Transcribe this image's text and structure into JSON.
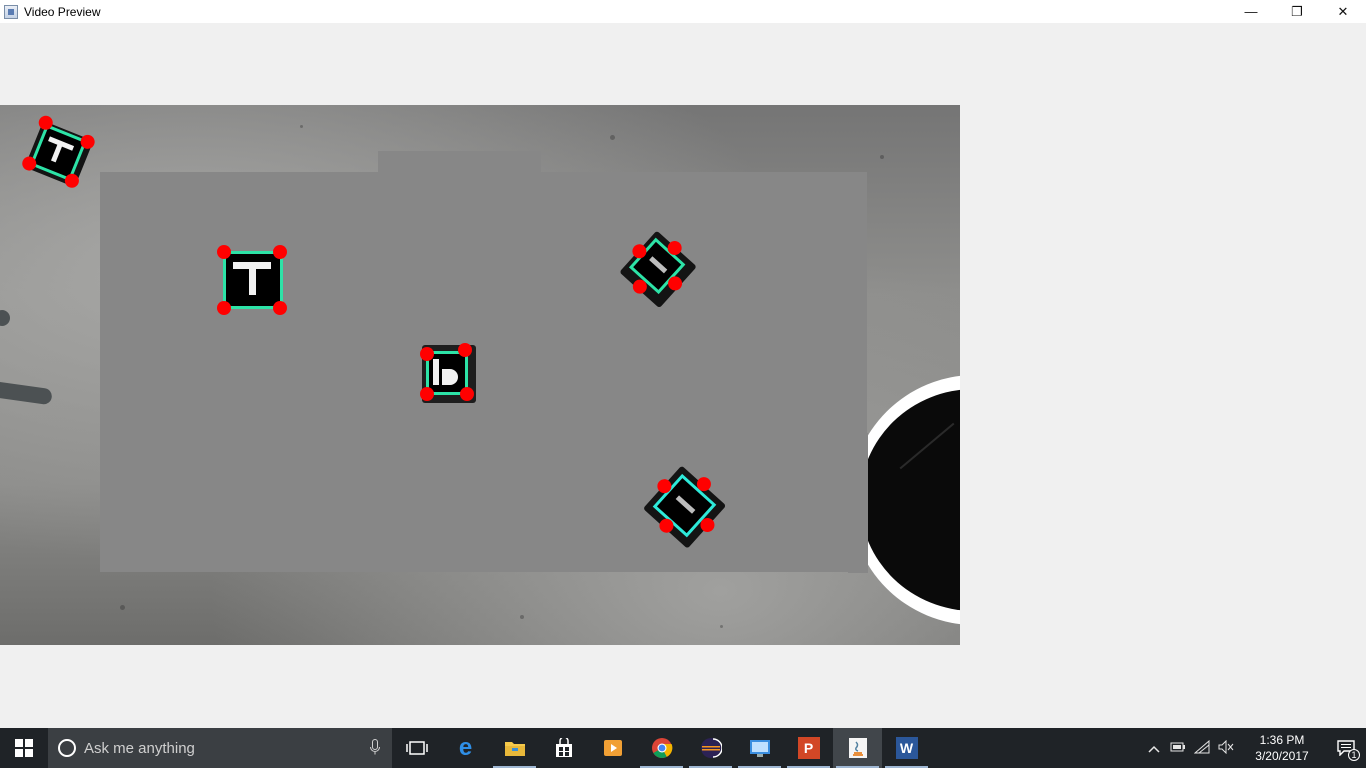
{
  "window": {
    "title": "Video Preview",
    "controls": {
      "minimize": "—",
      "restore": "❐",
      "close": "✕"
    }
  },
  "video": {
    "markers": [
      {
        "name": "marker-top-left-corner"
      },
      {
        "name": "marker-t-shape"
      },
      {
        "name": "marker-center"
      },
      {
        "name": "marker-right-upper"
      },
      {
        "name": "marker-right-lower"
      }
    ]
  },
  "taskbar": {
    "search_placeholder": "Ask me anything",
    "apps": [
      {
        "name": "task-view-icon",
        "glyph": ""
      },
      {
        "name": "edge-icon",
        "glyph": "e"
      },
      {
        "name": "file-explorer-icon",
        "glyph": ""
      },
      {
        "name": "store-icon",
        "glyph": ""
      },
      {
        "name": "media-player-icon",
        "glyph": ""
      },
      {
        "name": "chrome-icon",
        "glyph": ""
      },
      {
        "name": "eclipse-icon",
        "glyph": ""
      },
      {
        "name": "remote-desktop-icon",
        "glyph": ""
      },
      {
        "name": "powerpoint-icon",
        "glyph": "P"
      },
      {
        "name": "java-icon",
        "glyph": ""
      },
      {
        "name": "word-icon",
        "glyph": "W"
      }
    ],
    "clock": {
      "time": "1:36 PM",
      "date": "3/20/2017"
    },
    "notifications_count": "1"
  },
  "colors": {
    "marker_outline": "#2de3a7",
    "marker_corner": "#ff0000",
    "taskbar_bg": "#1f2327",
    "accent_underline": "#9fb7d3"
  }
}
